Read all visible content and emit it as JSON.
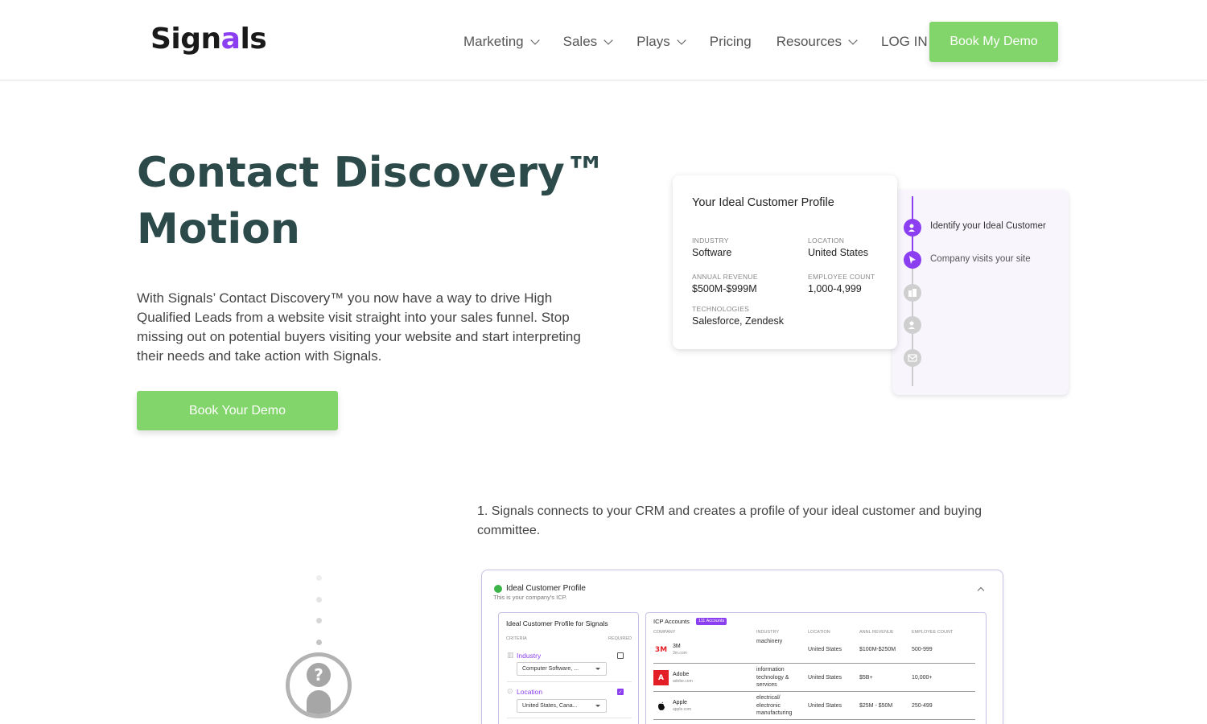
{
  "header": {
    "logo_text_start": "Sign",
    "logo_text_mark": "a",
    "logo_text_end": "ls",
    "nav": [
      {
        "label": "Marketing",
        "has_dropdown": true
      },
      {
        "label": "Sales",
        "has_dropdown": true
      },
      {
        "label": "Plays",
        "has_dropdown": true
      },
      {
        "label": "Pricing",
        "has_dropdown": false
      },
      {
        "label": "Resources",
        "has_dropdown": true
      },
      {
        "label": "LOG IN",
        "has_dropdown": false
      }
    ],
    "cta_label": "Book My Demo"
  },
  "hero": {
    "title_line1": "Contact Discovery™",
    "title_line2": "Motion",
    "description": "With Signals’ Contact Discovery™ you now have a way to drive High Qualified Leads from a website visit straight into your sales funnel. Stop missing out on potential buyers visiting your website and start interpreting their needs and take action with Signals.",
    "cta_label": "Book Your Demo"
  },
  "icp_card": {
    "title": "Your Ideal Customer Profile",
    "industry_label": "INDUSTRY",
    "industry_value": "Software",
    "location_label": "LOCATION",
    "location_value": "United States",
    "revenue_label": "ANNUAL REVENUE",
    "revenue_value": "$500M-$999M",
    "employee_label": "EMPLOYEE COUNT",
    "employee_value": "1,000-4,999",
    "tech_label": "TECHNOLOGIES",
    "tech_value": "Salesforce, Zendesk"
  },
  "timeline": {
    "steps": [
      {
        "label": "Identify your Ideal Customer",
        "icon": "user-search-icon",
        "active": true
      },
      {
        "label": "Company visits your site",
        "icon": "cursor-icon",
        "active": true
      },
      {
        "label": "",
        "icon": "building-icon",
        "active": false
      },
      {
        "label": "",
        "icon": "user-search-icon",
        "active": false
      },
      {
        "label": "",
        "icon": "mail-icon",
        "active": false
      }
    ]
  },
  "step1": {
    "text": "1. Signals connects to your CRM and creates a profile of your ideal customer and buying committee."
  },
  "app_screenshot": {
    "title": "Ideal Customer Profile",
    "subtitle": "This is your company's ICP.",
    "criteria": {
      "title": "Ideal Customer Profile for Signals",
      "col_criteria": "CRITERIA",
      "col_required": "REQUIRED",
      "items": [
        {
          "name": "Industry",
          "value": "Computer Software, ...",
          "required": false
        },
        {
          "name": "Location",
          "value": "United States, Cana...",
          "required": true
        }
      ]
    },
    "accounts": {
      "title": "ICP Accounts",
      "badge": "111 Accounts",
      "columns": [
        "COMPANY",
        "INDUSTRY",
        "LOCATION",
        "ANNL REVENUE",
        "EMPLOYEE COUNT"
      ],
      "rows": [
        {
          "logo": "3M",
          "name": "3M",
          "domain": "3m.com",
          "industry": "machinery",
          "location": "United States",
          "revenue": "$100M-$250M",
          "employees": "500-999"
        },
        {
          "logo": "A",
          "name": "Adobe",
          "domain": "adobe.com",
          "industry": "information technology & services",
          "location": "United States",
          "revenue": "$5B+",
          "employees": "10,000+"
        },
        {
          "logo": "",
          "name": "Apple",
          "domain": "apple.com",
          "industry": "electrical/ electronic manufacturing",
          "location": "United States",
          "revenue": "$25M - $50M",
          "employees": "250-499"
        }
      ]
    }
  },
  "colors": {
    "accent_green": "#82d56b",
    "brand_purple": "#8b3ff0",
    "title_teal": "#2c4a4a"
  }
}
